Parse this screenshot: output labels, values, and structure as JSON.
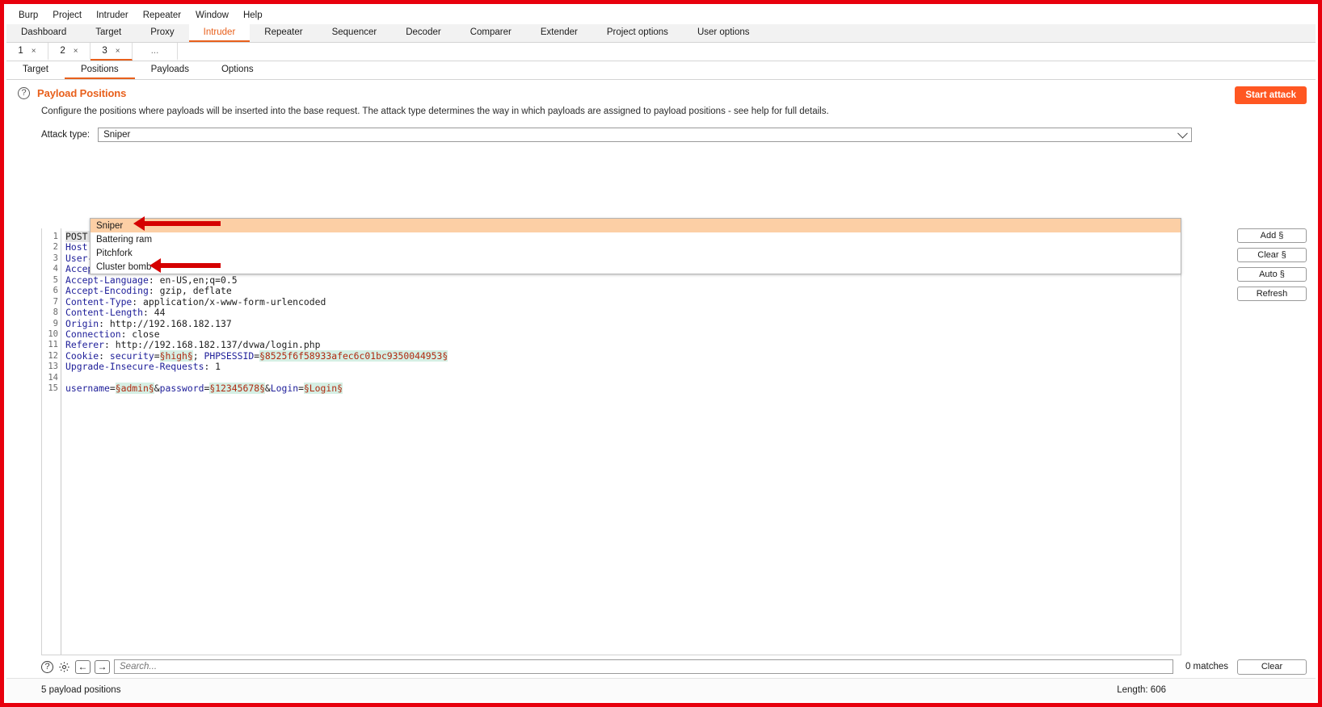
{
  "menubar": {
    "items": [
      "Burp",
      "Project",
      "Intruder",
      "Repeater",
      "Window",
      "Help"
    ]
  },
  "main_tabs": {
    "active": "Intruder",
    "items": [
      "Dashboard",
      "Target",
      "Proxy",
      "Intruder",
      "Repeater",
      "Sequencer",
      "Decoder",
      "Comparer",
      "Extender",
      "Project options",
      "User options"
    ]
  },
  "attack_tabs": {
    "active": "3",
    "items": [
      "1",
      "2",
      "3"
    ],
    "close_glyph": "×",
    "overflow_label": "..."
  },
  "inner_tabs": {
    "active": "Positions",
    "items": [
      "Target",
      "Positions",
      "Payloads",
      "Options"
    ]
  },
  "panel": {
    "help_icon": "?",
    "title": "Payload Positions",
    "description": "Configure the positions where payloads will be inserted into the base request. The attack type determines the way in which payloads are assigned to payload positions - see help for full details.",
    "start_attack_label": "Start attack"
  },
  "attack_type": {
    "label": "Attack type:",
    "selected": "Sniper",
    "options": [
      "Sniper",
      "Battering ram",
      "Pitchfork",
      "Cluster bomb"
    ],
    "dropdown_open": true,
    "highlighted_option": "Sniper"
  },
  "editor": {
    "line_numbers": [
      "1",
      "2",
      "3",
      "4",
      "5",
      "6",
      "7",
      "8",
      "9",
      "10",
      "11",
      "12",
      "13",
      "14",
      "15"
    ],
    "lines": [
      {
        "n": "1",
        "segments": [
          {
            "t": "POST ",
            "s": "sel1"
          },
          {
            "t": "/",
            "s": "sel1"
          }
        ]
      },
      {
        "n": "2",
        "segments": [
          {
            "t": "Host",
            "s": "hdr"
          },
          {
            "t": ":",
            "s": ""
          }
        ]
      },
      {
        "n": "3",
        "segments": [
          {
            "t": "User-A",
            "s": "hdr"
          }
        ]
      },
      {
        "n": "4",
        "segments": [
          {
            "t": "Accept",
            "s": "hdr"
          }
        ]
      },
      {
        "n": "5",
        "segments": [
          {
            "t": "Accept-Language",
            "s": "hdr"
          },
          {
            "t": ": en-US,en;q=0.5",
            "s": ""
          }
        ]
      },
      {
        "n": "6",
        "segments": [
          {
            "t": "Accept-Encoding",
            "s": "hdr"
          },
          {
            "t": ": gzip, deflate",
            "s": ""
          }
        ]
      },
      {
        "n": "7",
        "segments": [
          {
            "t": "Content-Type",
            "s": "hdr"
          },
          {
            "t": ": application/x-www-form-urlencoded",
            "s": ""
          }
        ]
      },
      {
        "n": "8",
        "segments": [
          {
            "t": "Content-Length",
            "s": "hdr"
          },
          {
            "t": ": 44",
            "s": ""
          }
        ]
      },
      {
        "n": "9",
        "segments": [
          {
            "t": "Origin",
            "s": "hdr"
          },
          {
            "t": ": http://192.168.182.137",
            "s": ""
          }
        ]
      },
      {
        "n": "10",
        "segments": [
          {
            "t": "Connection",
            "s": "hdr"
          },
          {
            "t": ": close",
            "s": ""
          }
        ]
      },
      {
        "n": "11",
        "segments": [
          {
            "t": "Referer",
            "s": "hdr"
          },
          {
            "t": ": http://192.168.182.137/dvwa/login.php",
            "s": ""
          }
        ]
      },
      {
        "n": "12",
        "segments": [
          {
            "t": "Cookie",
            "s": "hdr"
          },
          {
            "t": ": ",
            "s": ""
          },
          {
            "t": "security",
            "s": "hdr"
          },
          {
            "t": "=",
            "s": ""
          },
          {
            "t": "§high§",
            "s": "mark"
          },
          {
            "t": "; ",
            "s": ""
          },
          {
            "t": "PHPSESSID",
            "s": "hdr"
          },
          {
            "t": "=",
            "s": ""
          },
          {
            "t": "§8525f6f58933afec6c01bc9350044953§",
            "s": "mark"
          }
        ]
      },
      {
        "n": "13",
        "segments": [
          {
            "t": "Upgrade-Insecure-Requests",
            "s": "hdr"
          },
          {
            "t": ": 1",
            "s": ""
          }
        ]
      },
      {
        "n": "14",
        "segments": [
          {
            "t": "",
            "s": ""
          }
        ]
      },
      {
        "n": "15",
        "segments": [
          {
            "t": "username",
            "s": "hdr"
          },
          {
            "t": "=",
            "s": ""
          },
          {
            "t": "§admin§",
            "s": "mark"
          },
          {
            "t": "&",
            "s": ""
          },
          {
            "t": "password",
            "s": "hdr"
          },
          {
            "t": "=",
            "s": ""
          },
          {
            "t": "§12345678§",
            "s": "mark"
          },
          {
            "t": "&",
            "s": ""
          },
          {
            "t": "Login",
            "s": "hdr"
          },
          {
            "t": "=",
            "s": ""
          },
          {
            "t": "§Login§",
            "s": "mark"
          }
        ]
      }
    ]
  },
  "side_buttons": [
    "Add §",
    "Clear §",
    "Auto §",
    "Refresh"
  ],
  "search": {
    "help_icon": "?",
    "settings_icon": "gear-icon",
    "prev_glyph": "←",
    "next_glyph": "→",
    "placeholder": "Search...",
    "value": "",
    "matches": "0 matches",
    "clear_label": "Clear"
  },
  "status": {
    "left": "5 payload positions",
    "right": "Length: 606"
  },
  "colors": {
    "accent": "#e8601c",
    "start_attack_bg": "#ff5722",
    "dropdown_highlight": "#fccfa5",
    "payload_marker_bg": "#d5efe4",
    "payload_marker_fg": "#b02a10",
    "header_token": "#20209a",
    "annotation_arrow": "#d50000",
    "record_border": "#e8000d"
  }
}
